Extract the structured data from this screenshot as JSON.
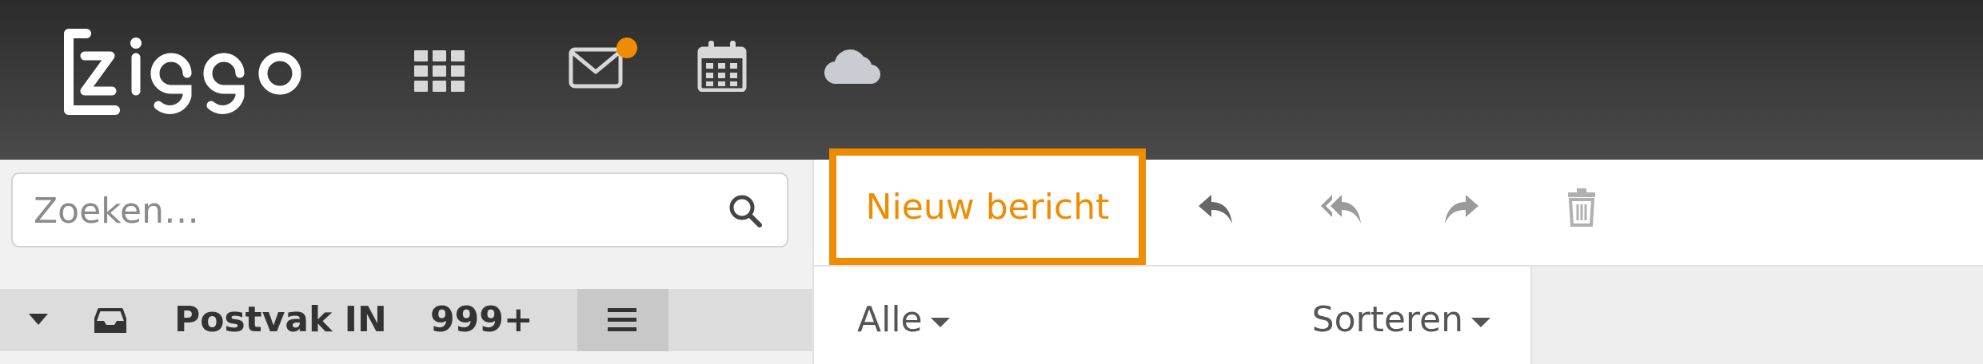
{
  "header": {
    "logo_text": "ziggo",
    "icons": [
      "apps-grid-icon",
      "mail-icon",
      "calendar-icon",
      "cloud-icon"
    ],
    "accent_color": "#f08c00"
  },
  "search": {
    "placeholder": "Zoeken…"
  },
  "folder": {
    "label": "Postvak IN",
    "count": "999+"
  },
  "toolbar": {
    "new_message_label": "Nieuw bericht",
    "icons": [
      "reply-icon",
      "reply-all-icon",
      "forward-icon",
      "delete-icon"
    ]
  },
  "list": {
    "filter_label": "Alle",
    "sort_label": "Sorteren"
  }
}
